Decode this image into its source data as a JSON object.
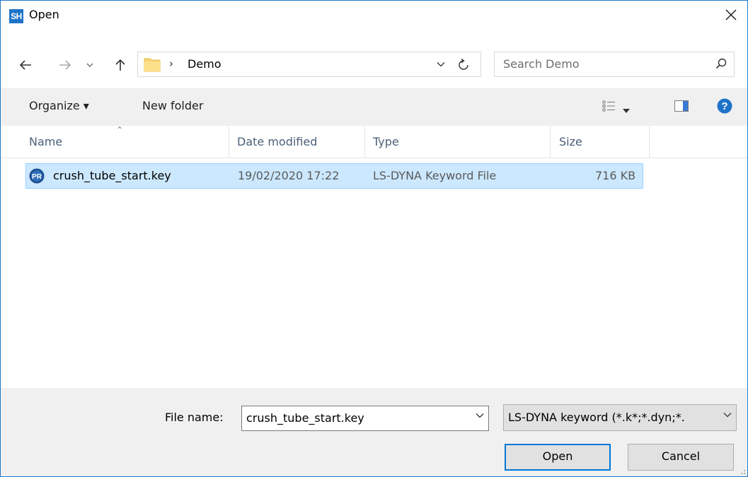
{
  "window": {
    "title": "Open",
    "app_icon_text": "SH"
  },
  "nav": {
    "breadcrumb": [
      "Demo"
    ],
    "search_placeholder": "Search Demo",
    "icons": [
      "back-arrow-icon",
      "forward-arrow-icon",
      "recent-dropdown-icon",
      "up-arrow-icon",
      "folder-icon",
      "chevron-down-icon",
      "refresh-icon",
      "search-icon"
    ]
  },
  "toolbar": {
    "organize_label": "Organize ▾",
    "new_folder_label": "New folder"
  },
  "columns": [
    "Name",
    "Date modified",
    "Type",
    "Size"
  ],
  "files": [
    {
      "name": "crush_tube_start.key",
      "date_modified": "19/02/2020 17:22",
      "type": "LS-DYNA Keyword File",
      "size": "716 KB",
      "selected": true,
      "icon": "PR"
    }
  ],
  "footer": {
    "file_name_label": "File name:",
    "file_name_value": "crush_tube_start.key",
    "file_type_value": "LS-DYNA keyword (*.k*;*.dyn;*.",
    "open_label": "Open",
    "cancel_label": "Cancel"
  },
  "colors": {
    "accent": "#0078d7",
    "selection": "#cce8ff",
    "selection_border": "#99d1ff",
    "help": "#1e73c8"
  }
}
